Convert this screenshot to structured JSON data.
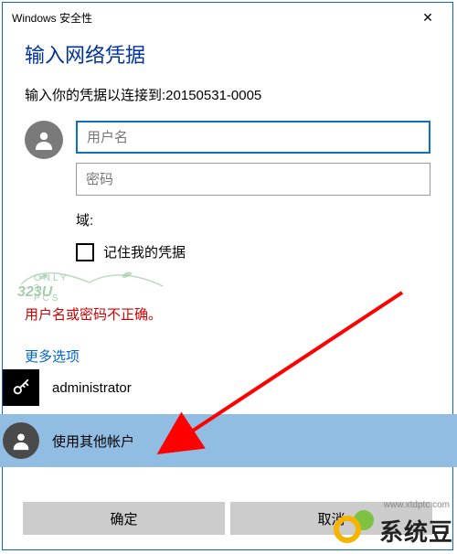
{
  "titlebar": {
    "title": "Windows 安全性"
  },
  "heading": "输入网络凭据",
  "subtitle_prefix": "输入你的凭据以连接到:",
  "target_host": "20150531-0005",
  "fields": {
    "username_placeholder": "用户名",
    "password_placeholder": "密码",
    "domain_label": "域:",
    "remember_label": "记住我的凭据"
  },
  "error_text": "用户名或密码不正确。",
  "more_options_label": "更多选项",
  "accounts": [
    {
      "label": "administrator",
      "kind": "saved"
    },
    {
      "label": "使用其他帐户",
      "kind": "other",
      "selected": true
    }
  ],
  "buttons": {
    "ok": "确定",
    "cancel": "取消"
  },
  "branding": {
    "site_name": "系统豆",
    "site_domain": "www.xtdptc.com",
    "wm_small": "ONLY   3 PCS",
    "wm_big": "323U"
  },
  "colors": {
    "accent": "#0c6fc0",
    "selection": "#91bde3",
    "error": "#d40000",
    "link": "#0066cc"
  }
}
